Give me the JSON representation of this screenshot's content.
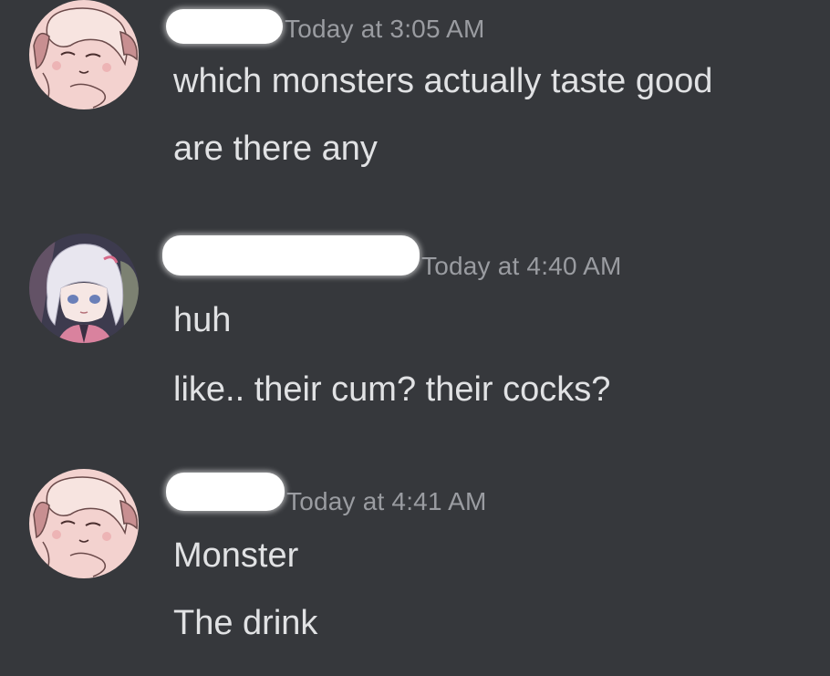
{
  "messages": [
    {
      "author_redacted": true,
      "timestamp": "Today at 3:05 AM",
      "lines": [
        "which monsters actually taste good",
        "are there any"
      ]
    },
    {
      "author_redacted": true,
      "timestamp": "Today at 4:40 AM",
      "lines": [
        "huh",
        "like.. their cum? their cocks?"
      ]
    },
    {
      "author_redacted": true,
      "timestamp": "Today at 4:41 AM",
      "lines": [
        "Monster",
        "The drink"
      ]
    }
  ],
  "colors": {
    "background": "#36383c",
    "timestamp": "#9a9ca1",
    "message_text": "#e1e2e4",
    "redaction": "#ffffff",
    "avatar_pink": "#f4d3d2",
    "avatar_dark_bg": "#3c3a4d"
  },
  "icons": {
    "avatar_1": "anime-girl-pink-avatar",
    "avatar_2": "anime-girl-white-hair-avatar"
  }
}
